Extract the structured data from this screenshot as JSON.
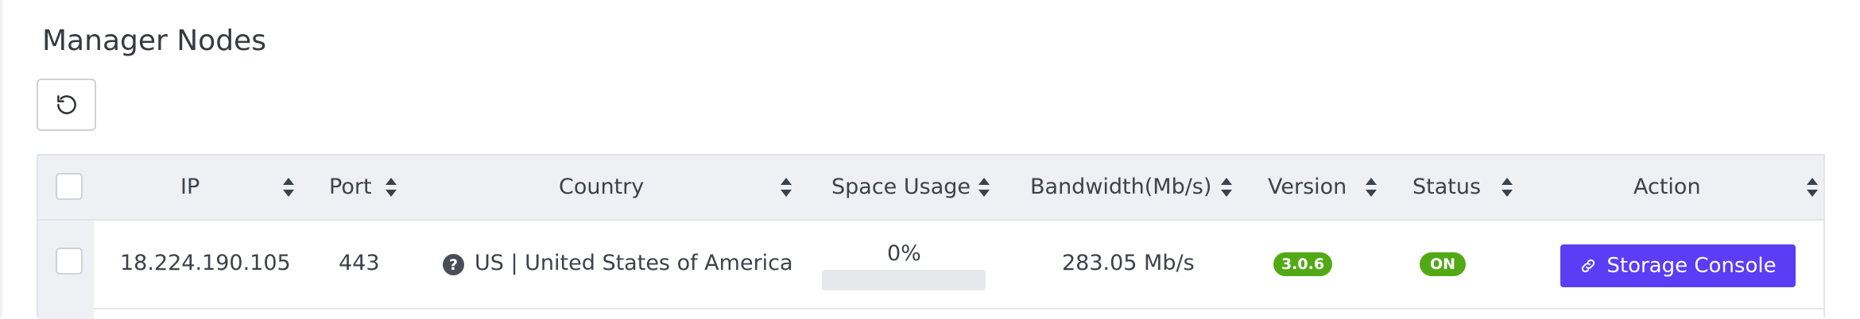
{
  "page": {
    "title": "Manager Nodes"
  },
  "toolbar": {
    "refresh_icon": "refresh-icon"
  },
  "table": {
    "columns": [
      {
        "key": "ip",
        "label": "IP"
      },
      {
        "key": "port",
        "label": "Port"
      },
      {
        "key": "country",
        "label": "Country"
      },
      {
        "key": "space_usage",
        "label": "Space Usage"
      },
      {
        "key": "bandwidth",
        "label": "Bandwidth(Mb/s)"
      },
      {
        "key": "version",
        "label": "Version"
      },
      {
        "key": "status",
        "label": "Status"
      },
      {
        "key": "action",
        "label": "Action"
      }
    ],
    "rows": [
      {
        "ip": "18.224.190.105",
        "port": "443",
        "country_icon": "question-circle-icon",
        "country_icon_glyph": "?",
        "country": "US | United States of America",
        "space_usage_label": "0%",
        "space_usage_fraction": 0,
        "bandwidth": "283.05 Mb/s",
        "version": "3.0.6",
        "status": "ON",
        "action_label": "Storage Console",
        "action_icon": "link-icon"
      }
    ]
  },
  "colors": {
    "accent": "#5b3df5",
    "badge_green": "#52a916",
    "header_bg": "#eef0f4",
    "text": "#3d4149"
  }
}
